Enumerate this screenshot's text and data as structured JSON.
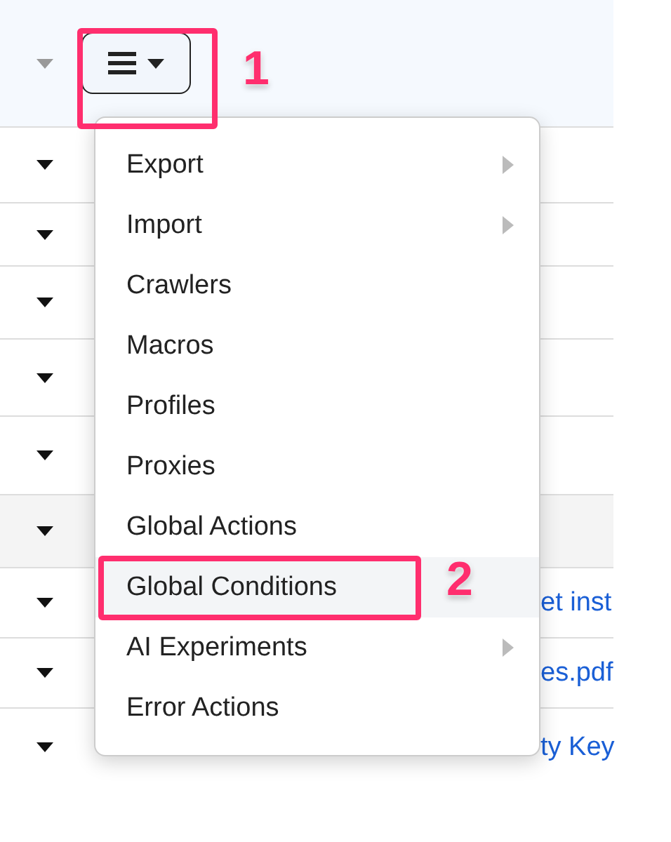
{
  "toolbar": {
    "menu_button": {
      "expanded": true
    }
  },
  "rows": [
    {
      "text": "",
      "shaded": false
    },
    {
      "text": "",
      "shaded": false
    },
    {
      "text": "",
      "shaded": false
    },
    {
      "text": "",
      "shaded": false
    },
    {
      "text": "",
      "shaded": false
    },
    {
      "text": "",
      "shaded": true
    },
    {
      "text": "et inst",
      "shaded": false
    },
    {
      "text": "es.pdf",
      "shaded": false
    },
    {
      "text": "ty Key",
      "shaded": false
    }
  ],
  "menu": {
    "items": [
      {
        "label": "Export",
        "submenu": true,
        "selected": false
      },
      {
        "label": "Import",
        "submenu": true,
        "selected": false
      },
      {
        "label": "Crawlers",
        "submenu": false,
        "selected": false
      },
      {
        "label": "Macros",
        "submenu": false,
        "selected": false
      },
      {
        "label": "Profiles",
        "submenu": false,
        "selected": false
      },
      {
        "label": "Proxies",
        "submenu": false,
        "selected": false
      },
      {
        "label": "Global Actions",
        "submenu": false,
        "selected": false
      },
      {
        "label": "Global Conditions",
        "submenu": false,
        "selected": true
      },
      {
        "label": "AI Experiments",
        "submenu": true,
        "selected": false
      },
      {
        "label": "Error Actions",
        "submenu": false,
        "selected": false
      }
    ]
  },
  "annotations": [
    {
      "label": "1"
    },
    {
      "label": "2"
    }
  ]
}
